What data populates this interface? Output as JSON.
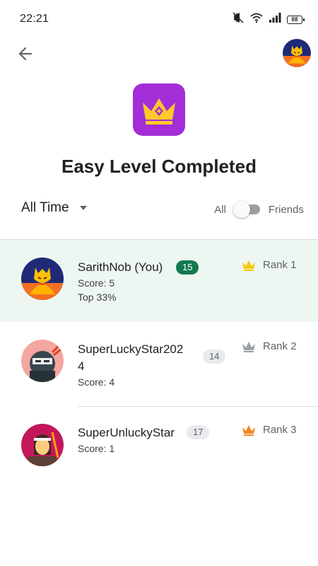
{
  "status": {
    "time": "22:21",
    "battery": "88"
  },
  "header": {
    "title": "Easy Level Completed"
  },
  "filters": {
    "time_range": "All Time",
    "toggle_left": "All",
    "toggle_right": "Friends",
    "toggle_on": false
  },
  "colors": {
    "accent": "#127a4f",
    "level_icon_bg": "#a32ed8",
    "crown_gold": "#f7c700",
    "crown_silver": "#9aa0a6",
    "crown_bronze": "#f08a24",
    "highlight_row": "#eef6f1"
  },
  "leaderboard": [
    {
      "name": "SarithNob (You)",
      "level": "15",
      "score": "Score: 5",
      "extra": "Top 33%",
      "rank": "Rank 1",
      "avatar": "dragon-avatar",
      "crown": "gold-crown-icon"
    },
    {
      "name_line1": "SuperLuckyStar202",
      "name_line2": "4",
      "level": "14",
      "score": "Score: 4",
      "rank": "Rank 2",
      "avatar": "ninja-avatar",
      "crown": "silver-crown-icon"
    },
    {
      "name": "SuperUnluckyStar",
      "level": "17",
      "score": "Score: 1",
      "rank": "Rank 3",
      "avatar": "warrior-avatar",
      "crown": "bronze-crown-icon"
    }
  ]
}
